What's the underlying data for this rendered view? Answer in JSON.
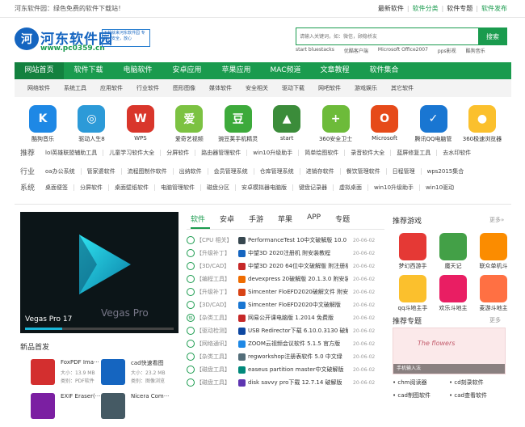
{
  "topbar": {
    "welcome": "河东软件园：绿色免费的软件下载站！",
    "links": [
      "最新软件",
      "软件分类",
      "软件专题",
      "软件发布"
    ]
  },
  "logo": {
    "mark": "河",
    "name": "河东软件园",
    "url": "www.pc0359.cn",
    "slogan": "下载就来河东软件园 专业，安全，放心"
  },
  "search": {
    "placeholder": "请输入关键词，如：微信，顾稳桥友",
    "button": "搜索",
    "hotwords": [
      "start bluestacks",
      "优酷客户端",
      "Microsoft Office2007",
      "pps影视",
      "酷狗音乐"
    ]
  },
  "nav": {
    "items": [
      "网站首页",
      "软件下载",
      "电脑软件",
      "安卓应用",
      "苹果应用",
      "MAC频道",
      "文章教程",
      "软件集合"
    ]
  },
  "subnav": {
    "items": [
      "网络软件",
      "系统工具",
      "应用软件",
      "行业软件",
      "图形图像",
      "媒体软件",
      "安全相关",
      "驱动下载",
      "网吧软件",
      "游戏娱乐",
      "其它软件"
    ]
  },
  "apps": [
    {
      "label": "酷狗音乐",
      "color": "#1e88e5",
      "glyph": "K"
    },
    {
      "label": "驱动人生8",
      "color": "#2c9ad8",
      "glyph": "◎"
    },
    {
      "label": "WPS",
      "color": "#d9362b",
      "glyph": "W"
    },
    {
      "label": "爱奇艺视频",
      "color": "#7cc242",
      "glyph": "爱"
    },
    {
      "label": "豌豆荚手机精灵",
      "color": "#3daa3b",
      "glyph": "豆"
    },
    {
      "label": "start",
      "color": "#3b8c3a",
      "glyph": "▲"
    },
    {
      "label": "360安全卫士",
      "color": "#6dbb3a",
      "glyph": "+"
    },
    {
      "label": "Microsoft",
      "color": "#e64a19",
      "glyph": "O"
    },
    {
      "label": "腾讯QQ电脑管",
      "color": "#1976d2",
      "glyph": "✓"
    },
    {
      "label": "360极速浏览器",
      "color": "#fbc02d",
      "glyph": "●"
    }
  ],
  "tagrows": [
    {
      "head": "推荐",
      "tags": [
        "lol英雄联盟辅助工具",
        "儿童学习软件大全",
        "分屏软件",
        "路由器管理软件",
        "win10升级助手",
        "简单绘图软件",
        "录音软件大全",
        "蓝屏修复工具",
        "去水印软件"
      ]
    },
    {
      "head": "行业",
      "tags": [
        "oa办公系统",
        "管家婆软件",
        "流程图制作软件",
        "出纳软件",
        "会员管理系统",
        "仓库管理系统",
        "进销存软件",
        "餐饮管理软件",
        "日程管理",
        "wps2015集合"
      ]
    },
    {
      "head": "系统",
      "tags": [
        "桌面便签",
        "分屏软件",
        "桌面壁纸软件",
        "电脑管理软件",
        "磁盘分区",
        "安卓模拟器电脑版",
        "键盘记录器",
        "虚拟桌面",
        "win10升级助手",
        "win10驱动"
      ]
    }
  ],
  "slider": {
    "caption": "Vegas Pro 17",
    "watermark": "Vegas Pro",
    "progress_fraction": 0.25
  },
  "new_title": "新品首发",
  "new_items": [
    {
      "name": "FoxPDF Ima···",
      "size": "大小：13.9 MB",
      "category": "类别：PDF软件",
      "color": "#d32f2f"
    },
    {
      "name": "cad快速看图",
      "size": "大小：23.2 MB",
      "category": "类别：图像浏览",
      "color": "#1565c0"
    },
    {
      "name": "EXIF Eraser(···",
      "size": "",
      "category": "",
      "color": "#7b1fa2"
    },
    {
      "name": "Nicera Com···",
      "size": "",
      "category": "",
      "color": "#455a64"
    }
  ],
  "tabs": [
    "软件",
    "安卓",
    "手游",
    "苹果",
    "APP",
    "专题"
  ],
  "list": [
    {
      "badge": "",
      "cat": "【CPU 相关】",
      "title": "PerformanceTest 10中文破解版 10.0",
      "date": "20-06-02",
      "icon": "#37474f"
    },
    {
      "badge": "",
      "cat": "【升级补丁】",
      "title": "中望3D 2020注册机 附安装教程",
      "date": "20-06-02",
      "icon": "#1565c0"
    },
    {
      "badge": "",
      "cat": "【3D/CAD】",
      "title": "中望3D 2020 64位中文破解版 附注册机",
      "date": "20-06-02",
      "icon": "#c62828"
    },
    {
      "badge": "",
      "cat": "【编程工具】",
      "title": "devexpress 20破解版 20.1.3.0 附安装",
      "date": "20-06-02",
      "icon": "#ef6c00"
    },
    {
      "badge": "",
      "cat": "【升级补丁】",
      "title": "Simcenter FloEFD2020破解文件 附安",
      "date": "20-06-02",
      "icon": "#d84315"
    },
    {
      "badge": "",
      "cat": "【3D/CAD】",
      "title": "Simcenter FloEFD2020中文破解版",
      "date": "20-06-02",
      "icon": "#1976d2"
    },
    {
      "badge": "热",
      "cat": "【杂类工具】",
      "title": "网易公开课电脑版 1.2014 免费版",
      "date": "20-06-02",
      "icon": "#c62828"
    },
    {
      "badge": "",
      "cat": "【驱动检测】",
      "title": "USB Redirector下载 6.10.0.3130 破解",
      "date": "20-06-02",
      "icon": "#0d47a1"
    },
    {
      "badge": "",
      "cat": "【网络通讯】",
      "title": "ZOOM云视频会议软件 5.1.5 官方版",
      "date": "20-06-02",
      "icon": "#1e88e5"
    },
    {
      "badge": "",
      "cat": "【杂类工具】",
      "title": "regworkshop注册表软件 5.0 中文绿",
      "date": "20-06-02",
      "icon": "#546e7a"
    },
    {
      "badge": "",
      "cat": "【磁盘工具】",
      "title": "easeus partition master中文破解版",
      "date": "20-06-02",
      "icon": "#00897b"
    },
    {
      "badge": "",
      "cat": "【磁盘工具】",
      "title": "disk savvy pro下载 12.7.14 破解版",
      "date": "20-06-02",
      "icon": "#5e35b1"
    }
  ],
  "games_title": "推荐游戏",
  "games_more": "更多»",
  "games": [
    {
      "label": "梦幻西游手",
      "color": "#e53935"
    },
    {
      "label": "魔天记",
      "color": "#43a047"
    },
    {
      "label": "联众单机斗",
      "color": "#fb8c00"
    },
    {
      "label": "qq斗地主手",
      "color": "#fbc02d"
    },
    {
      "label": "欢乐斗地主",
      "color": "#e91e63"
    },
    {
      "label": "麦游斗地主",
      "color": "#ff7043"
    }
  ],
  "topics_title": "推荐专题",
  "topics_more": "更多",
  "topic_image": {
    "text": "The flowers",
    "caption": "手机输入法"
  },
  "topic_links": [
    "chm阅读器",
    "cd刻录软件",
    "cad制图软件",
    "cad查看软件"
  ]
}
